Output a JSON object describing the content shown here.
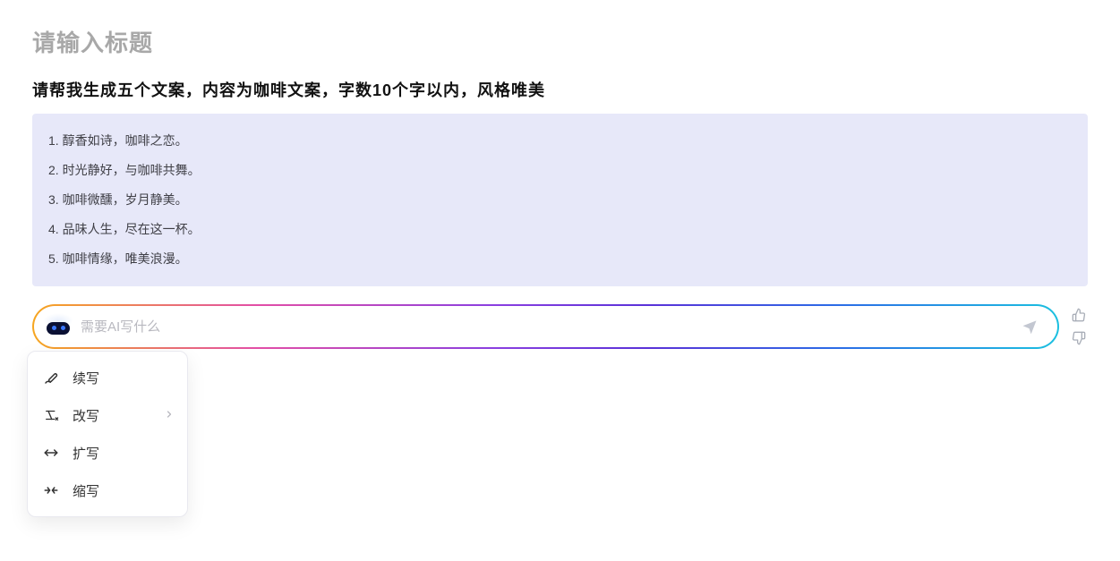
{
  "title_placeholder": "请输入标题",
  "prompt": "请帮我生成五个文案，内容为咖啡文案，字数10个字以内，风格唯美",
  "responses": [
    "1. 醇香如诗，咖啡之恋。",
    "2. 时光静好，与咖啡共舞。",
    "3. 咖啡微醺，岁月静美。",
    "4. 品味人生，尽在这一杯。",
    "5. 咖啡情缘，唯美浪漫。"
  ],
  "ai_input": {
    "placeholder": "需要AI写什么"
  },
  "menu": {
    "items": [
      {
        "label": "续写"
      },
      {
        "label": "改写",
        "has_sub": true
      },
      {
        "label": "扩写"
      },
      {
        "label": "缩写"
      }
    ]
  }
}
